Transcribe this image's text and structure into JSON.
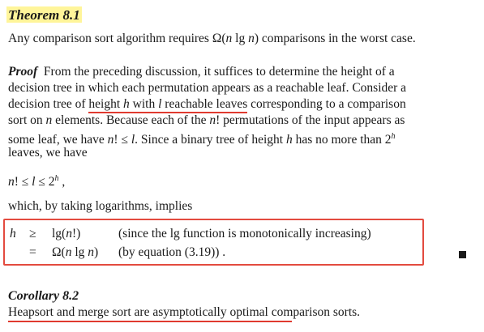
{
  "theorem": {
    "heading": "Theorem 8.1",
    "statement_pre": "Any comparison sort algorithm requires ",
    "statement_bound": "Ω(n lg n)",
    "statement_post": " comparisons in the worst case."
  },
  "proof": {
    "label": "Proof",
    "lines": [
      "From the preceding discussion, it suffices to determine the height of a",
      "decision tree in which each permutation appears as a reachable leaf. Consider a"
    ],
    "line3_pre": "decision tree of ",
    "line3_underlined": "height h with l reachable leaves",
    "line3_post": " corresponding to a comparison",
    "line4": "sort on n elements. Because each of the n! permutations of the input appears as",
    "line5": "some leaf, we have n! ≤ l. Since a binary tree of height h has no more than 2",
    "line5_sup": "h",
    "line6": "leaves, we have",
    "inequality": "n! ≤ l ≤ 2",
    "inequality_sup": "h",
    "inequality_tail": " ,",
    "which_line": "which, by taking logarithms, implies"
  },
  "derivation": {
    "rows": [
      {
        "lhs": "h",
        "rel": "≥",
        "rhs": "lg(n!)",
        "note": "(since the lg function is monotonically increasing)"
      },
      {
        "lhs": "",
        "rel": "=",
        "rhs": "Ω(n lg n)",
        "note": "(by equation (3.19))  ."
      }
    ]
  },
  "corollary": {
    "heading": "Corollary 8.2",
    "statement": "Heapsort and merge sort are asymptotically optimal comparison sorts."
  },
  "colors": {
    "highlight": "#fff59a",
    "annotation_red": "#e03a2f",
    "text": "#1a1a1a"
  }
}
